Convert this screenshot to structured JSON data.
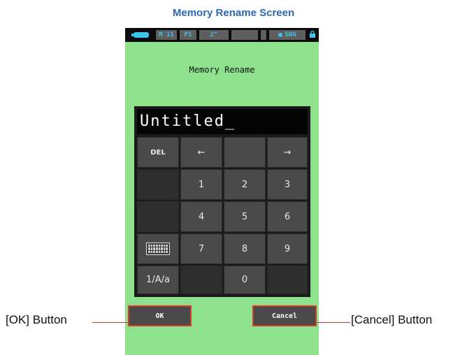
{
  "caption": "Memory Rename Screen",
  "status_bar": {
    "memory": "M 11",
    "preset": "P1",
    "angle": "2°",
    "mode": "SNG"
  },
  "screen_title": "Memory Rename",
  "text_field": {
    "value": "Untitled_"
  },
  "keys": {
    "del": "DEL",
    "left": "←",
    "right": "→",
    "k1": "1",
    "k2": "2",
    "k3": "3",
    "k4": "4",
    "k5": "5",
    "k6": "6",
    "k7": "7",
    "k8": "8",
    "k9": "9",
    "k0": "0",
    "mode": "1/A/a"
  },
  "buttons": {
    "ok": "OK",
    "cancel": "Cancel"
  },
  "callouts": {
    "ok": "[OK] Button",
    "cancel": "[Cancel] Button"
  },
  "colors": {
    "screen_bg": "#8ee28e",
    "highlight": "#d83a2a",
    "caption": "#2d68b5"
  }
}
